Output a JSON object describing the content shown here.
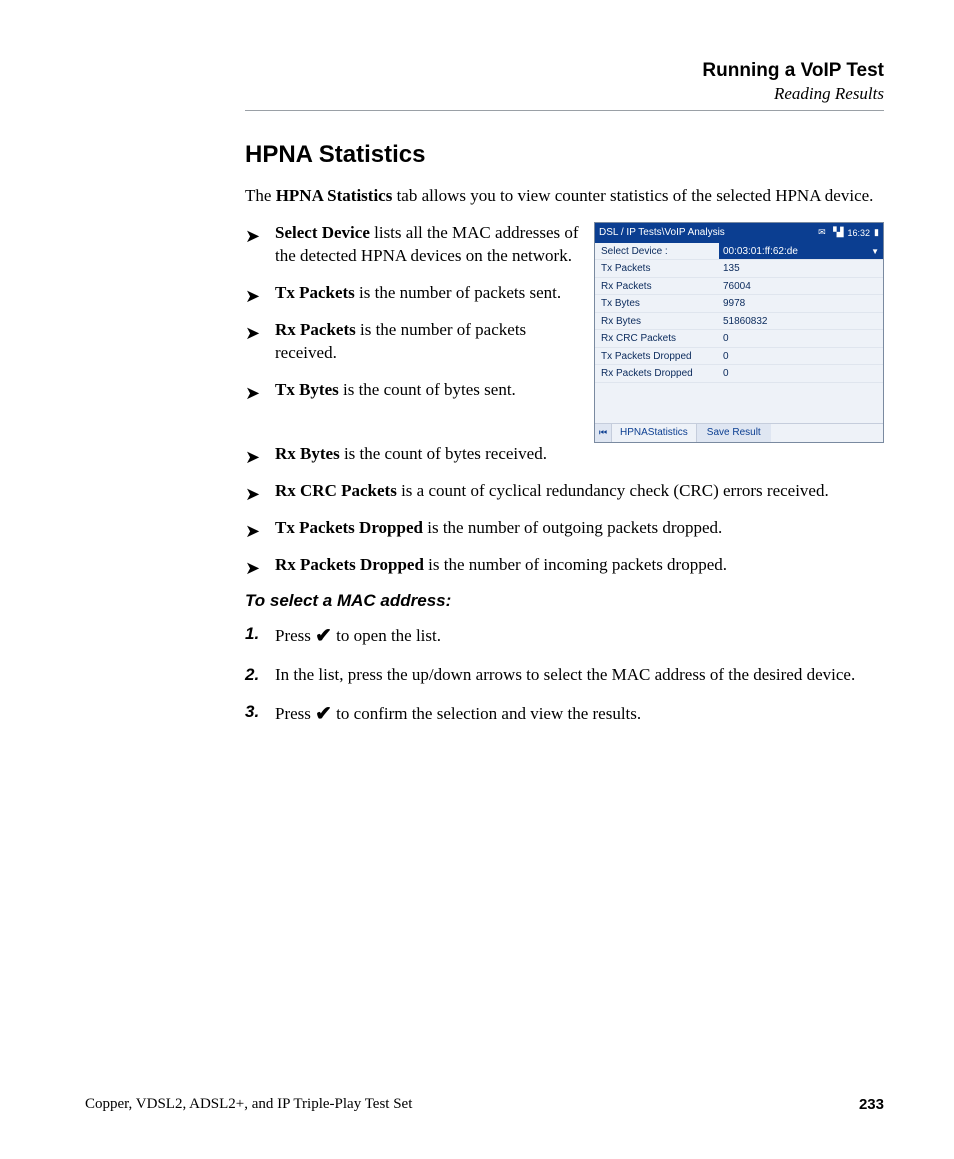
{
  "header": {
    "title": "Running a VoIP Test",
    "subtitle": "Reading Results"
  },
  "section": {
    "title": "HPNA Statistics",
    "intro_pre": "The ",
    "intro_bold": "HPNA Statistics",
    "intro_post": " tab allows you to view counter statistics of the selected HPNA device."
  },
  "bullets_left": [
    {
      "bold": "Select Device",
      "rest": " lists all the MAC addresses of the detected HPNA devices on the network."
    },
    {
      "bold": "Tx Packets",
      "rest": " is the number of packets sent."
    },
    {
      "bold": "Rx Packets",
      "rest": " is the number of packets received."
    },
    {
      "bold": "Tx Bytes",
      "rest": " is the count of bytes sent."
    }
  ],
  "bullets_full": [
    {
      "bold": "Rx Bytes",
      "rest": " is the count of bytes received."
    },
    {
      "bold": "Rx CRC Packets",
      "rest": " is a count of cyclical redundancy check (CRC) errors received."
    },
    {
      "bold": "Tx Packets Dropped",
      "rest": " is the number of outgoing packets dropped."
    },
    {
      "bold": "Rx Packets Dropped",
      "rest": " is the number of incoming packets dropped."
    }
  ],
  "screenshot": {
    "titlebar": "DSL / IP Tests\\VoIP Analysis",
    "time": "16:32",
    "select_label": "Select Device :",
    "select_value": "00:03:01:ff:62:de",
    "rows": [
      {
        "label": "Tx Packets",
        "value": "135"
      },
      {
        "label": "Rx Packets",
        "value": "76004"
      },
      {
        "label": "Tx Bytes",
        "value": "9978"
      },
      {
        "label": "Rx Bytes",
        "value": "51860832"
      },
      {
        "label": "Rx CRC Packets",
        "value": "0"
      },
      {
        "label": "Tx Packets Dropped",
        "value": "0"
      },
      {
        "label": "Rx Packets Dropped",
        "value": "0"
      }
    ],
    "tab": "HPNAStatistics",
    "button": "Save Result"
  },
  "procedure": {
    "heading": "To select a MAC address:",
    "steps": [
      {
        "pre": "Press ",
        "post": " to open the list."
      },
      {
        "full": "In the list, press the up/down arrows to select the MAC address of the desired device."
      },
      {
        "pre": "Press ",
        "post": " to confirm the selection and view the results."
      }
    ]
  },
  "footer": {
    "left": "Copper, VDSL2, ADSL2+, and IP Triple-Play Test Set",
    "page": "233"
  }
}
